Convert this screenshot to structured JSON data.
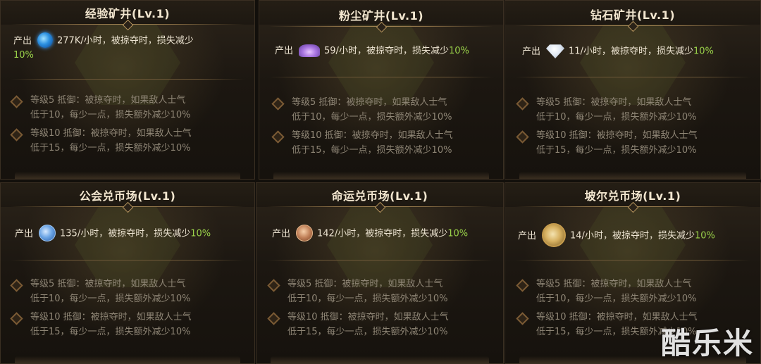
{
  "panels": [
    {
      "title": "经验矿井(Lv.1)",
      "produce_label": "产出",
      "icon": "exp-orb-icon",
      "rate": "277K/小时，被掠夺时，损失减少",
      "reduction": "10%",
      "bonus5_line1": "等级5 抵御：被掠夺时，如果敌人士气",
      "bonus5_line2": "低于10，每少一点，损失额外减少10%",
      "bonus10_line1": "等级10 抵御：被掠夺时，如果敌人士气",
      "bonus10_line2": "低于15，每少一点，损失额外减少10%"
    },
    {
      "title": "粉尘矿井(Lv.1)",
      "produce_label": "产出",
      "icon": "dust-crystal-icon",
      "rate": "59/小时，被掠夺时，损失减少",
      "reduction": "10%",
      "bonus5_line1": "等级5 抵御：被掠夺时，如果敌人士气",
      "bonus5_line2": "低于10，每少一点，损失额外减少10%",
      "bonus10_line1": "等级10 抵御：被掠夺时，如果敌人士气",
      "bonus10_line2": "低于15，每少一点，损失额外减少10%"
    },
    {
      "title": "钻石矿井(Lv.1)",
      "produce_label": "产出",
      "icon": "diamond-icon",
      "rate": "11/小时，被掠夺时，损失减少",
      "reduction": "10%",
      "bonus5_line1": "等级5 抵御：被掠夺时，如果敌人士气",
      "bonus5_line2": "低于10，每少一点，损失额外减少10%",
      "bonus10_line1": "等级10 抵御：被掠夺时，如果敌人士气",
      "bonus10_line2": "低于15，每少一点，损失额外减少10%"
    },
    {
      "title": "公会兑币场(Lv.1)",
      "produce_label": "产出",
      "icon": "guild-coin-icon",
      "rate": "135/小时，被掠夺时，损失减少",
      "reduction": "10%",
      "bonus5_line1": "等级5 抵御：被掠夺时，如果敌人士气",
      "bonus5_line2": "低于10，每少一点，损失额外减少10%",
      "bonus10_line1": "等级10 抵御：被掠夺时，如果敌人士气",
      "bonus10_line2": "低于15，每少一点，损失额外减少10%"
    },
    {
      "title": "命运兑币场(Lv.1)",
      "produce_label": "产出",
      "icon": "fate-coin-icon",
      "rate": "142/小时，被掠夺时，损失减少",
      "reduction": "10%",
      "bonus5_line1": "等级5 抵御：被掠夺时，如果敌人士气",
      "bonus5_line2": "低于10，每少一点，损失额外减少10%",
      "bonus10_line1": "等级10 抵御：被掠夺时，如果敌人士气",
      "bonus10_line2": "低于15，每少一点，损失额外减少10%"
    },
    {
      "title": "坡尔兑币场(Lv.1)",
      "produce_label": "产出",
      "icon": "bol-coin-icon",
      "rate": "14/小时，被掠夺时，损失减少",
      "reduction": "10%",
      "bonus5_line1": "等级5 抵御：被掠夺时，如果敌人士气",
      "bonus5_line2": "低于10，每少一点，损失额外减少10%",
      "bonus10_line1": "等级10 抵御：被掠夺时，如果敌人士气",
      "bonus10_line2": "低于15，每少一点，损失额外减少10%"
    }
  ],
  "watermark": "酷乐米",
  "colors": {
    "title_text": "#f2e6cf",
    "body_text": "#ece3d1",
    "bonus_text": "#8e8575",
    "reduction_green": "#9ad24a",
    "divider_gold": "#8c7046"
  }
}
